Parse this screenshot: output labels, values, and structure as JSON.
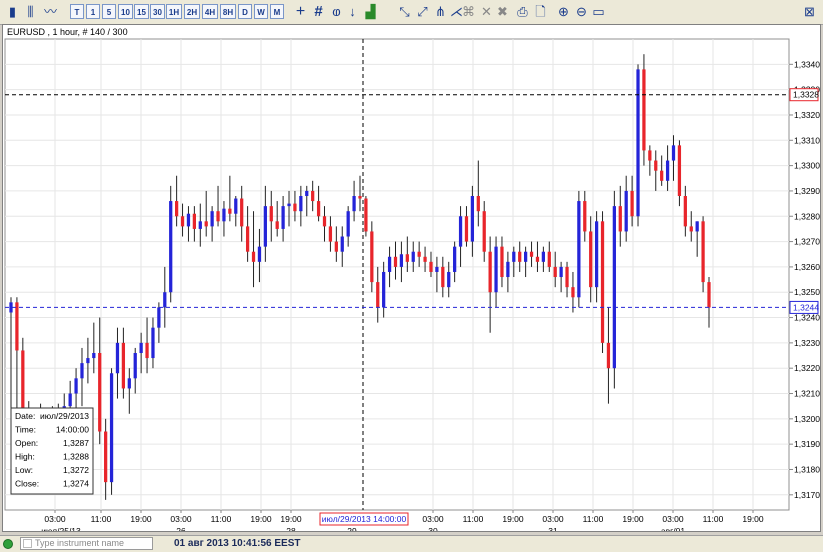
{
  "toolbar": {
    "period_buttons": [
      "T",
      "1",
      "5",
      "10",
      "15",
      "30",
      "1H",
      "2H",
      "4H",
      "8H",
      "D",
      "W",
      "M"
    ]
  },
  "chart_data": {
    "type": "candlestick",
    "title": "EURUSD , 1 hour, # 140 / 300",
    "ylim": [
      1.3164,
      1.335
    ],
    "y_ticks": [
      "1,3170",
      "1,3180",
      "1,3190",
      "1,3200",
      "1,3210",
      "1,3220",
      "1,3230",
      "1,3240",
      "1,3250",
      "1,3260",
      "1,3270",
      "1,3280",
      "1,3290",
      "1,3300",
      "1,3310",
      "1,3320",
      "1,3330",
      "1,3340"
    ],
    "x_tick_labels": [
      "03:00",
      "11:00",
      "19:00",
      "03:00",
      "11:00",
      "19:00",
      "19:00",
      "03:00",
      "11:00",
      "19:00",
      "03:00",
      "11:00",
      "19:00",
      "03:00",
      "11:00",
      "19:00"
    ],
    "x_date_labels": [
      "июл/25/13",
      "26",
      "28",
      "29",
      "30",
      "31",
      "авг/01"
    ],
    "crosshair_label": "июл/29/2013 14:00:00",
    "crosshair_price": "1,3328",
    "current_price": "1,3244",
    "bull_color": "#2424d8",
    "bear_color": "#e8252b",
    "candles": [
      {
        "o": 1.3242,
        "h": 1.3248,
        "l": 1.3186,
        "c": 1.3246
      },
      {
        "o": 1.3246,
        "h": 1.3248,
        "l": 1.3186,
        "c": 1.3227
      },
      {
        "o": 1.3227,
        "h": 1.3232,
        "l": 1.319,
        "c": 1.3203
      },
      {
        "o": 1.3203,
        "h": 1.3207,
        "l": 1.3188,
        "c": 1.3196
      },
      {
        "o": 1.3196,
        "h": 1.3201,
        "l": 1.319,
        "c": 1.3199
      },
      {
        "o": 1.3199,
        "h": 1.3206,
        "l": 1.3193,
        "c": 1.3195
      },
      {
        "o": 1.3195,
        "h": 1.32,
        "l": 1.319,
        "c": 1.3198
      },
      {
        "o": 1.3198,
        "h": 1.3205,
        "l": 1.3194,
        "c": 1.3196
      },
      {
        "o": 1.3196,
        "h": 1.3206,
        "l": 1.3191,
        "c": 1.3204
      },
      {
        "o": 1.3204,
        "h": 1.321,
        "l": 1.3198,
        "c": 1.3205
      },
      {
        "o": 1.3205,
        "h": 1.3215,
        "l": 1.3202,
        "c": 1.321
      },
      {
        "o": 1.321,
        "h": 1.322,
        "l": 1.32,
        "c": 1.3216
      },
      {
        "o": 1.3216,
        "h": 1.3228,
        "l": 1.3205,
        "c": 1.3222
      },
      {
        "o": 1.3222,
        "h": 1.3232,
        "l": 1.3214,
        "c": 1.3224
      },
      {
        "o": 1.3224,
        "h": 1.3238,
        "l": 1.3218,
        "c": 1.3226
      },
      {
        "o": 1.3226,
        "h": 1.324,
        "l": 1.319,
        "c": 1.3195
      },
      {
        "o": 1.3195,
        "h": 1.32,
        "l": 1.3168,
        "c": 1.3175
      },
      {
        "o": 1.3175,
        "h": 1.322,
        "l": 1.317,
        "c": 1.3218
      },
      {
        "o": 1.3218,
        "h": 1.3236,
        "l": 1.3208,
        "c": 1.323
      },
      {
        "o": 1.323,
        "h": 1.3236,
        "l": 1.3208,
        "c": 1.3212
      },
      {
        "o": 1.3212,
        "h": 1.322,
        "l": 1.3202,
        "c": 1.3216
      },
      {
        "o": 1.3216,
        "h": 1.3228,
        "l": 1.321,
        "c": 1.3226
      },
      {
        "o": 1.3226,
        "h": 1.3234,
        "l": 1.3218,
        "c": 1.323
      },
      {
        "o": 1.323,
        "h": 1.324,
        "l": 1.3218,
        "c": 1.3224
      },
      {
        "o": 1.3224,
        "h": 1.324,
        "l": 1.322,
        "c": 1.3236
      },
      {
        "o": 1.3236,
        "h": 1.3246,
        "l": 1.323,
        "c": 1.3244
      },
      {
        "o": 1.3244,
        "h": 1.326,
        "l": 1.3236,
        "c": 1.325
      },
      {
        "o": 1.325,
        "h": 1.3292,
        "l": 1.3246,
        "c": 1.3286
      },
      {
        "o": 1.3286,
        "h": 1.3296,
        "l": 1.3276,
        "c": 1.328
      },
      {
        "o": 1.328,
        "h": 1.3285,
        "l": 1.3272,
        "c": 1.3276
      },
      {
        "o": 1.3276,
        "h": 1.3284,
        "l": 1.327,
        "c": 1.3281
      },
      {
        "o": 1.3281,
        "h": 1.3284,
        "l": 1.327,
        "c": 1.3275
      },
      {
        "o": 1.3275,
        "h": 1.3285,
        "l": 1.3268,
        "c": 1.3278
      },
      {
        "o": 1.3278,
        "h": 1.329,
        "l": 1.3272,
        "c": 1.3276
      },
      {
        "o": 1.3276,
        "h": 1.3284,
        "l": 1.327,
        "c": 1.3282
      },
      {
        "o": 1.3282,
        "h": 1.3292,
        "l": 1.3276,
        "c": 1.3278
      },
      {
        "o": 1.3278,
        "h": 1.3286,
        "l": 1.3272,
        "c": 1.3283
      },
      {
        "o": 1.3283,
        "h": 1.3296,
        "l": 1.3278,
        "c": 1.3281
      },
      {
        "o": 1.3281,
        "h": 1.3288,
        "l": 1.3276,
        "c": 1.3287
      },
      {
        "o": 1.3287,
        "h": 1.3292,
        "l": 1.327,
        "c": 1.3276
      },
      {
        "o": 1.3276,
        "h": 1.3284,
        "l": 1.3262,
        "c": 1.3266
      },
      {
        "o": 1.3266,
        "h": 1.3282,
        "l": 1.3252,
        "c": 1.3262
      },
      {
        "o": 1.3262,
        "h": 1.3275,
        "l": 1.3254,
        "c": 1.3268
      },
      {
        "o": 1.3268,
        "h": 1.3292,
        "l": 1.3262,
        "c": 1.3284
      },
      {
        "o": 1.3284,
        "h": 1.329,
        "l": 1.327,
        "c": 1.3278
      },
      {
        "o": 1.3278,
        "h": 1.3286,
        "l": 1.3272,
        "c": 1.3275
      },
      {
        "o": 1.3275,
        "h": 1.3288,
        "l": 1.327,
        "c": 1.3284
      },
      {
        "o": 1.3284,
        "h": 1.329,
        "l": 1.3276,
        "c": 1.3285
      },
      {
        "o": 1.3285,
        "h": 1.329,
        "l": 1.3278,
        "c": 1.3282
      },
      {
        "o": 1.3282,
        "h": 1.3292,
        "l": 1.3276,
        "c": 1.3288
      },
      {
        "o": 1.3288,
        "h": 1.3292,
        "l": 1.328,
        "c": 1.329
      },
      {
        "o": 1.329,
        "h": 1.3294,
        "l": 1.3282,
        "c": 1.3286
      },
      {
        "o": 1.3286,
        "h": 1.3292,
        "l": 1.3278,
        "c": 1.328
      },
      {
        "o": 1.328,
        "h": 1.3284,
        "l": 1.327,
        "c": 1.3276
      },
      {
        "o": 1.3276,
        "h": 1.328,
        "l": 1.3266,
        "c": 1.327
      },
      {
        "o": 1.327,
        "h": 1.3276,
        "l": 1.3262,
        "c": 1.3266
      },
      {
        "o": 1.3266,
        "h": 1.3276,
        "l": 1.326,
        "c": 1.3272
      },
      {
        "o": 1.3272,
        "h": 1.3284,
        "l": 1.3268,
        "c": 1.3282
      },
      {
        "o": 1.3282,
        "h": 1.3294,
        "l": 1.3278,
        "c": 1.3288
      },
      {
        "o": 1.3288,
        "h": 1.3296,
        "l": 1.3282,
        "c": 1.3287
      },
      {
        "o": 1.3287,
        "h": 1.3288,
        "l": 1.3272,
        "c": 1.3274
      },
      {
        "o": 1.3274,
        "h": 1.3278,
        "l": 1.325,
        "c": 1.3254
      },
      {
        "o": 1.3254,
        "h": 1.326,
        "l": 1.3238,
        "c": 1.3244
      },
      {
        "o": 1.3244,
        "h": 1.3262,
        "l": 1.324,
        "c": 1.3258
      },
      {
        "o": 1.3258,
        "h": 1.3268,
        "l": 1.3252,
        "c": 1.3264
      },
      {
        "o": 1.3264,
        "h": 1.327,
        "l": 1.3255,
        "c": 1.326
      },
      {
        "o": 1.326,
        "h": 1.327,
        "l": 1.3254,
        "c": 1.3265
      },
      {
        "o": 1.3265,
        "h": 1.3272,
        "l": 1.3258,
        "c": 1.3262
      },
      {
        "o": 1.3262,
        "h": 1.327,
        "l": 1.3258,
        "c": 1.3266
      },
      {
        "o": 1.3266,
        "h": 1.327,
        "l": 1.326,
        "c": 1.3264
      },
      {
        "o": 1.3264,
        "h": 1.3268,
        "l": 1.3258,
        "c": 1.3262
      },
      {
        "o": 1.3262,
        "h": 1.3266,
        "l": 1.3256,
        "c": 1.3258
      },
      {
        "o": 1.3258,
        "h": 1.3264,
        "l": 1.325,
        "c": 1.326
      },
      {
        "o": 1.326,
        "h": 1.3264,
        "l": 1.3248,
        "c": 1.3252
      },
      {
        "o": 1.3252,
        "h": 1.3262,
        "l": 1.3248,
        "c": 1.3258
      },
      {
        "o": 1.3258,
        "h": 1.327,
        "l": 1.3254,
        "c": 1.3268
      },
      {
        "o": 1.3268,
        "h": 1.3284,
        "l": 1.326,
        "c": 1.328
      },
      {
        "o": 1.328,
        "h": 1.3284,
        "l": 1.3268,
        "c": 1.327
      },
      {
        "o": 1.327,
        "h": 1.3292,
        "l": 1.3264,
        "c": 1.3288
      },
      {
        "o": 1.3288,
        "h": 1.3302,
        "l": 1.3276,
        "c": 1.3282
      },
      {
        "o": 1.3282,
        "h": 1.3286,
        "l": 1.3262,
        "c": 1.3266
      },
      {
        "o": 1.3266,
        "h": 1.3272,
        "l": 1.3234,
        "c": 1.325
      },
      {
        "o": 1.325,
        "h": 1.3272,
        "l": 1.3244,
        "c": 1.3268
      },
      {
        "o": 1.3268,
        "h": 1.3272,
        "l": 1.3252,
        "c": 1.3256
      },
      {
        "o": 1.3256,
        "h": 1.3266,
        "l": 1.325,
        "c": 1.3262
      },
      {
        "o": 1.3262,
        "h": 1.3268,
        "l": 1.3256,
        "c": 1.3266
      },
      {
        "o": 1.3266,
        "h": 1.327,
        "l": 1.3258,
        "c": 1.3262
      },
      {
        "o": 1.3262,
        "h": 1.3268,
        "l": 1.3256,
        "c": 1.3266
      },
      {
        "o": 1.3266,
        "h": 1.327,
        "l": 1.326,
        "c": 1.3264
      },
      {
        "o": 1.3264,
        "h": 1.327,
        "l": 1.3258,
        "c": 1.3262
      },
      {
        "o": 1.3262,
        "h": 1.3268,
        "l": 1.3258,
        "c": 1.3266
      },
      {
        "o": 1.3266,
        "h": 1.327,
        "l": 1.3258,
        "c": 1.326
      },
      {
        "o": 1.326,
        "h": 1.3266,
        "l": 1.3252,
        "c": 1.3256
      },
      {
        "o": 1.3256,
        "h": 1.3262,
        "l": 1.325,
        "c": 1.326
      },
      {
        "o": 1.326,
        "h": 1.3262,
        "l": 1.3248,
        "c": 1.3252
      },
      {
        "o": 1.3252,
        "h": 1.3258,
        "l": 1.3242,
        "c": 1.3248
      },
      {
        "o": 1.3248,
        "h": 1.329,
        "l": 1.3244,
        "c": 1.3286
      },
      {
        "o": 1.3286,
        "h": 1.329,
        "l": 1.327,
        "c": 1.3274
      },
      {
        "o": 1.3274,
        "h": 1.328,
        "l": 1.3246,
        "c": 1.3252
      },
      {
        "o": 1.3252,
        "h": 1.3282,
        "l": 1.3246,
        "c": 1.3278
      },
      {
        "o": 1.3278,
        "h": 1.3282,
        "l": 1.3226,
        "c": 1.323
      },
      {
        "o": 1.323,
        "h": 1.3244,
        "l": 1.3206,
        "c": 1.322
      },
      {
        "o": 1.322,
        "h": 1.329,
        "l": 1.3212,
        "c": 1.3284
      },
      {
        "o": 1.3284,
        "h": 1.3292,
        "l": 1.3268,
        "c": 1.3274
      },
      {
        "o": 1.3274,
        "h": 1.3296,
        "l": 1.327,
        "c": 1.329
      },
      {
        "o": 1.329,
        "h": 1.3296,
        "l": 1.3276,
        "c": 1.328
      },
      {
        "o": 1.328,
        "h": 1.334,
        "l": 1.3276,
        "c": 1.3338
      },
      {
        "o": 1.3338,
        "h": 1.3344,
        "l": 1.33,
        "c": 1.3306
      },
      {
        "o": 1.3306,
        "h": 1.3308,
        "l": 1.3296,
        "c": 1.3302
      },
      {
        "o": 1.3302,
        "h": 1.3306,
        "l": 1.329,
        "c": 1.3298
      },
      {
        "o": 1.3298,
        "h": 1.3304,
        "l": 1.3292,
        "c": 1.3294
      },
      {
        "o": 1.3294,
        "h": 1.3308,
        "l": 1.329,
        "c": 1.3302
      },
      {
        "o": 1.3302,
        "h": 1.3312,
        "l": 1.3294,
        "c": 1.3308
      },
      {
        "o": 1.3308,
        "h": 1.331,
        "l": 1.3284,
        "c": 1.3288
      },
      {
        "o": 1.3288,
        "h": 1.3292,
        "l": 1.3272,
        "c": 1.3276
      },
      {
        "o": 1.3276,
        "h": 1.3282,
        "l": 1.327,
        "c": 1.3274
      },
      {
        "o": 1.3274,
        "h": 1.3278,
        "l": 1.3264,
        "c": 1.3278
      },
      {
        "o": 1.3278,
        "h": 1.328,
        "l": 1.325,
        "c": 1.3254
      },
      {
        "o": 1.3254,
        "h": 1.3256,
        "l": 1.3236,
        "c": 1.3244
      }
    ]
  },
  "info_box": {
    "rows": [
      {
        "label": "Date:",
        "value": "июл/29/2013"
      },
      {
        "label": "Time:",
        "value": "14:00:00"
      },
      {
        "label": "Open:",
        "value": "1,3287"
      },
      {
        "label": "High:",
        "value": "1,3288"
      },
      {
        "label": "Low:",
        "value": "1,3272"
      },
      {
        "label": "Close:",
        "value": "1,3274"
      }
    ]
  },
  "status": {
    "search_placeholder": "Type instrument name",
    "server_time": "01 авг 2013 10:41:56 EEST"
  }
}
